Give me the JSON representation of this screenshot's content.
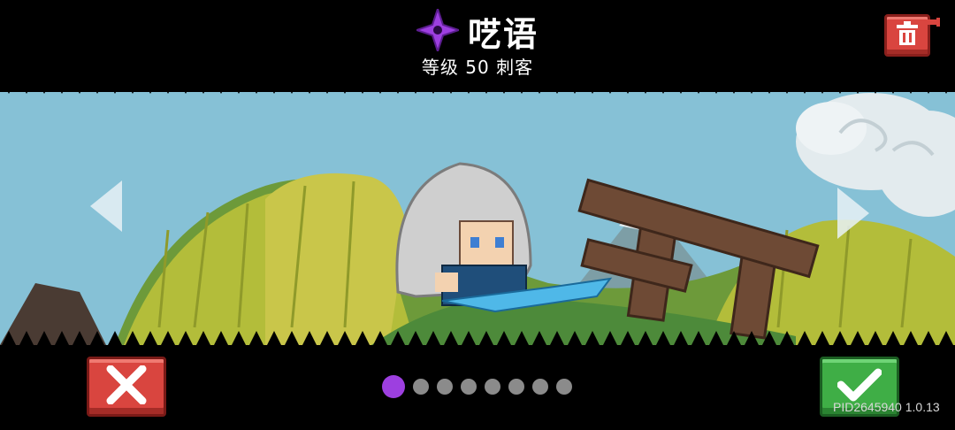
{
  "header": {
    "character_name": "呓语",
    "subtitle": "等级 50 刺客",
    "class_icon": "purple-shuriken-icon",
    "delete_icon": "trash-icon"
  },
  "navigation": {
    "prev_icon": "arrow-left-icon",
    "next_icon": "arrow-right-icon"
  },
  "actions": {
    "cancel_icon": "close-x-icon",
    "confirm_icon": "check-icon"
  },
  "pager": {
    "total": 8,
    "active_index": 0
  },
  "footer": {
    "version": "PID2645940 1.0.13"
  },
  "colors": {
    "accent_purple": "#9d3fe0",
    "cancel_red": "#d9453f",
    "confirm_green": "#3fae46",
    "sky": "#86c1d6",
    "grass": "#b3bd3a"
  }
}
